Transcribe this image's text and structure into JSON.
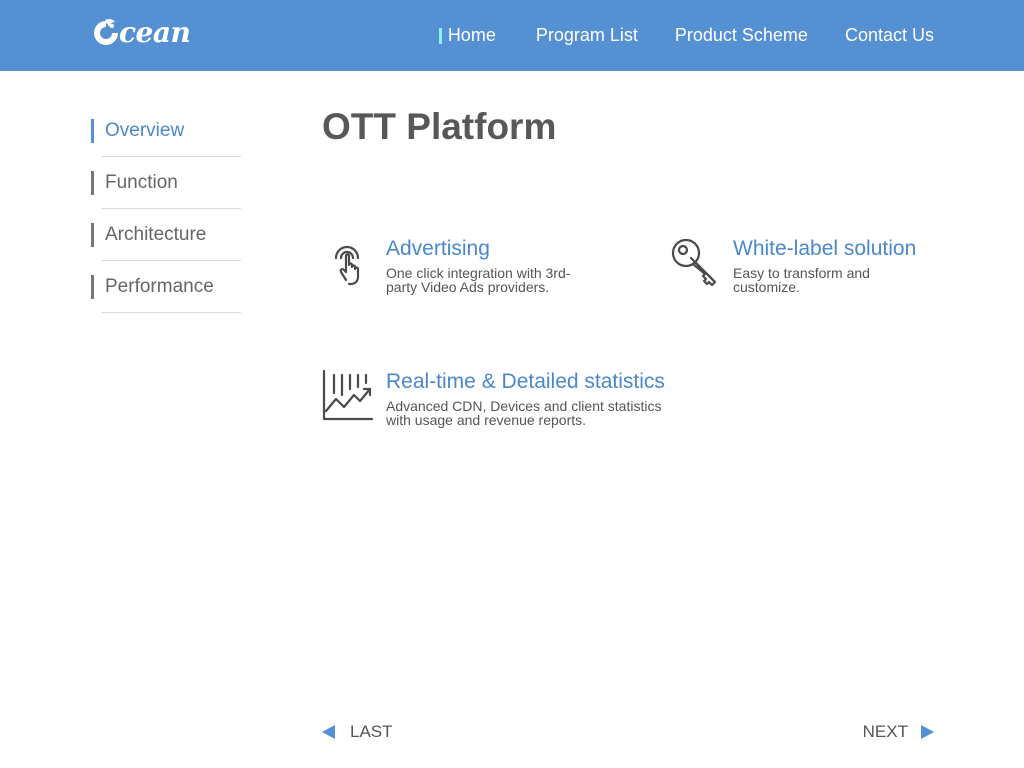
{
  "brand": {
    "logo_text": "cean",
    "logo_icon": "ocean-wave-logo-icon"
  },
  "nav": {
    "items": [
      {
        "label": "Home",
        "active": true
      },
      {
        "label": "Program List"
      },
      {
        "label": "Product Scheme"
      },
      {
        "label": "Contact Us"
      }
    ]
  },
  "sidebar": {
    "items": [
      {
        "label": "Overview",
        "active": true
      },
      {
        "label": "Function"
      },
      {
        "label": "Architecture"
      },
      {
        "label": "Performance"
      }
    ]
  },
  "main": {
    "title": "OTT Platform",
    "features": [
      {
        "icon": "touch-finger-icon",
        "title": "Advertising",
        "description": "One click integration with 3rd-party Video Ads providers."
      },
      {
        "icon": "key-icon",
        "title": "White-label solution",
        "description": "Easy to transform and customize."
      },
      {
        "icon": "statistics-chart-icon",
        "title": "Real-time & Detailed statistics",
        "description": "Advanced CDN, Devices and client statistics with usage and revenue reports."
      }
    ]
  },
  "pager": {
    "prev_label": "LAST",
    "next_label": "NEXT"
  },
  "colors": {
    "header_bg": "#5590d2",
    "accent": "#4a87cc",
    "active_nav_marker": "#8ff0ff",
    "text": "#555555"
  }
}
